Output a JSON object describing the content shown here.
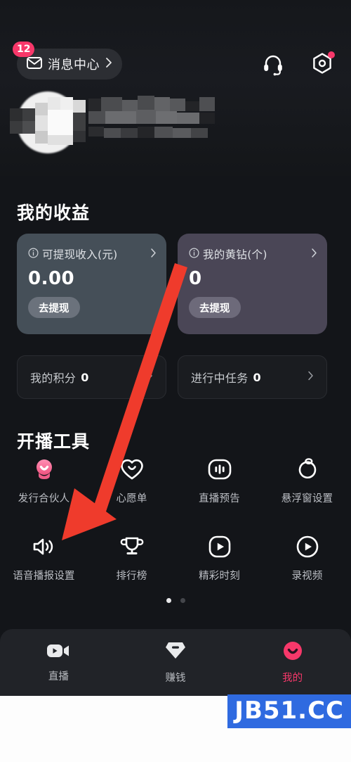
{
  "header": {
    "message_center": {
      "label": "消息中心",
      "badge": "12",
      "chevron": "›"
    },
    "icons": [
      {
        "name": "headset-icon",
        "has_dot": false
      },
      {
        "name": "settings-hex-icon",
        "has_dot": true
      }
    ]
  },
  "profile": {
    "censored": true
  },
  "earnings": {
    "title": "我的收益",
    "cards": [
      {
        "label": "可提现收入(元)",
        "value": "0.00",
        "button": "去提现",
        "chevron": "›",
        "info_icon": "info-circle-icon",
        "bg": "#454f58"
      },
      {
        "label": "我的黄钻(个)",
        "value": "0",
        "button": "去提现",
        "chevron": "›",
        "info_icon": "info-circle-icon",
        "bg": "#4a4656"
      }
    ],
    "stats": [
      {
        "label": "我的积分",
        "value": "0",
        "chevron": "›"
      },
      {
        "label": "进行中任务",
        "value": "0",
        "chevron": "›"
      }
    ]
  },
  "tools": {
    "title": "开播工具",
    "items": [
      {
        "label": "发行合伙人",
        "icon": "pink-avatar-icon"
      },
      {
        "label": "心愿单",
        "icon": "heart-icon"
      },
      {
        "label": "直播预告",
        "icon": "broadcast-preview-icon"
      },
      {
        "label": "悬浮窗设置",
        "icon": "floating-window-icon"
      },
      {
        "label": "语音播报设置",
        "icon": "speaker-icon"
      },
      {
        "label": "排行榜",
        "icon": "trophy-icon"
      },
      {
        "label": "精彩时刻",
        "icon": "play-square-icon"
      },
      {
        "label": "录视频",
        "icon": "play-circle-icon"
      }
    ],
    "pager": {
      "count": 2,
      "active": 0
    }
  },
  "bottom_nav": {
    "items": [
      {
        "label": "直播",
        "icon": "video-camera-icon",
        "active": false
      },
      {
        "label": "赚钱",
        "icon": "diamond-icon",
        "active": false
      },
      {
        "label": "我的",
        "icon": "smiley-avatar-icon",
        "active": true
      }
    ],
    "active_color": "#f7386a"
  },
  "watermark": {
    "text": "JB51.CC",
    "bg": "#2f6ae0"
  },
  "annotation": {
    "type": "arrow",
    "color": "#ef3b2c",
    "points_to": "语音播报设置"
  }
}
